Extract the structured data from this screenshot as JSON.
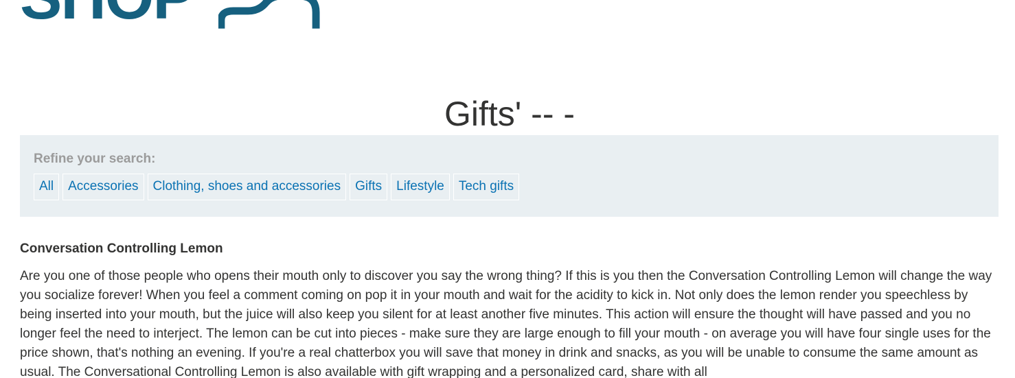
{
  "brand": {
    "logo_text": "SHOP",
    "colors": {
      "brand": "#16607f",
      "link": "#0a72b3",
      "panel_bg": "#e9eff2",
      "text": "#333332",
      "muted": "#9b9b9b"
    }
  },
  "page_title": "Gifts' -- -",
  "filter": {
    "heading": "Refine your search:",
    "categories": [
      "All",
      "Accessories",
      "Clothing, shoes and accessories",
      "Gifts",
      "Lifestyle",
      "Tech gifts"
    ]
  },
  "product": {
    "title": "Conversation Controlling Lemon",
    "description": "Are you one of those people who opens their mouth only to discover you say the wrong thing? If this is you then the Conversation Controlling Lemon will change the way you socialize forever! When you feel a comment coming on pop it in your mouth and wait for the acidity to kick in. Not only does the lemon render you speechless by being inserted into your mouth, but the juice will also keep you silent for at least another five minutes. This action will ensure the thought will have passed and you no longer feel the need to interject. The lemon can be cut into pieces - make sure they are large enough to fill your mouth - on average you will have four single uses for the price shown, that's nothing an evening. If you're a real chatterbox you will save that money in drink and snacks, as you will be unable to consume the same amount as usual. The Conversational Controlling Lemon is also available with gift wrapping and a personalized card, share with all"
  }
}
